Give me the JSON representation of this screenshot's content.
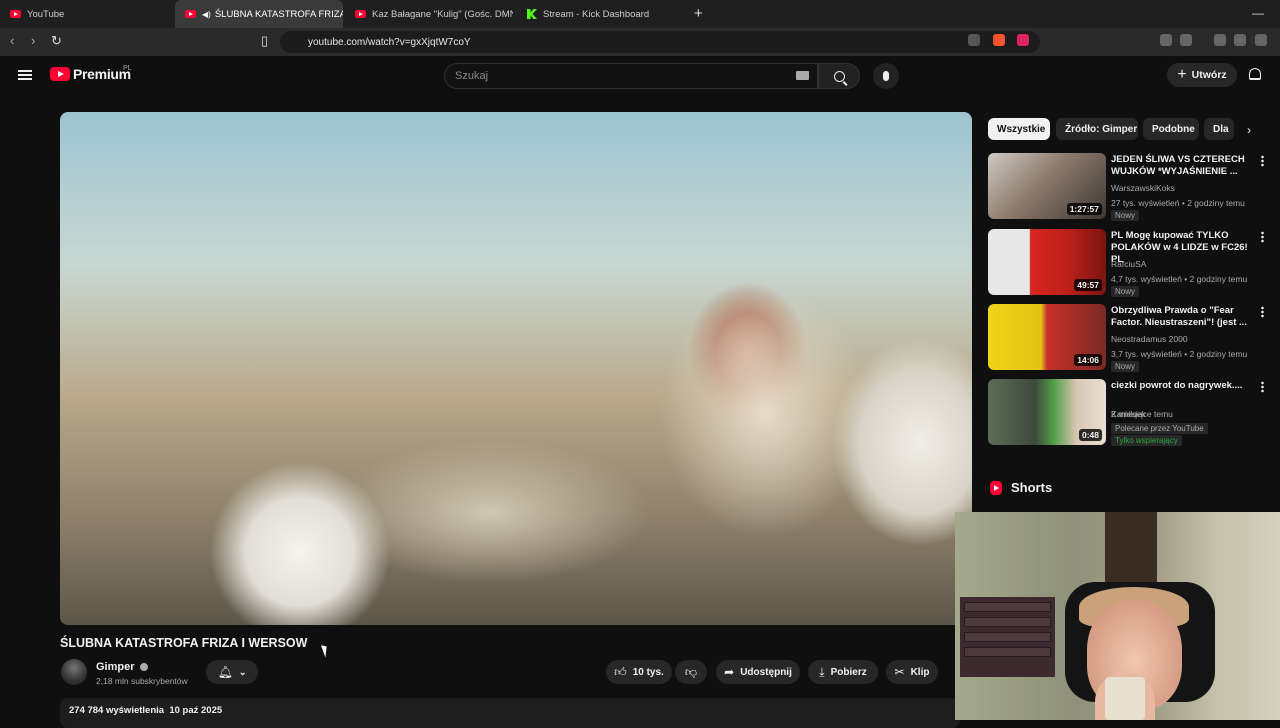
{
  "browser": {
    "tabs": [
      {
        "title": "YouTube",
        "icon": "youtube-icon"
      },
      {
        "title": "ŚLUBNA KATASTROFA FRIZA I",
        "icon": "youtube-icon",
        "active": true
      },
      {
        "title": "Kaz Bałagane \"Kulig\" (Gośc. DMN)@",
        "icon": "youtube-icon"
      },
      {
        "title": "Stream - Kick Dashboard",
        "icon": "kick-icon"
      }
    ],
    "new_tab": "+",
    "minimize": "—",
    "url": "youtube.com/watch?v=gxXjqtW7coY"
  },
  "youtube": {
    "logo": "Premium",
    "logo_region": "PL",
    "search_placeholder": "Szukaj",
    "create_label": "Utwórz",
    "video": {
      "title": "ŚLUBNA KATASTROFA FRIZA I WERSOW",
      "channel": "Gimper",
      "subscribers": "2,18 mln subskrybentów",
      "likes": "10 tys.",
      "share": "Udostępnij",
      "download": "Pobierz",
      "clip": "Klip",
      "views_date": "274 784 wyświetlenia  10 paź 2025"
    },
    "chips": [
      "Wszystkie",
      "Źródło: Gimper",
      "Podobne",
      "Dla"
    ],
    "recommendations": [
      {
        "title": "JEDEN ŚLIWA VS CZTERECH WUJKÓW *WYJAŚNIENIE ...",
        "channel": "WarszawskiKoks",
        "meta": "27 tys. wyświetleń • 2 godziny temu",
        "badge": "Nowy",
        "duration": "1:27:57"
      },
      {
        "title": "PL Mogę kupować TYLKO POLAKÓW w 4 LIDZE w FC26! PL",
        "channel": "RafciuSA",
        "meta": "4,7 tys. wyświetleń • 2 godziny temu",
        "badge": "Nowy",
        "duration": "49:57"
      },
      {
        "title": "Obrzydliwa Prawda o \"Fear Factor. Nieustraszeni\"! (jest ...",
        "channel": "Neostradamus 2000",
        "meta": "3,7 tys. wyświetleń • 2 godziny temu",
        "badge": "Nowy",
        "duration": "14:06"
      },
      {
        "title": "ciezki powrot do nagrywek....",
        "channel": "Kamilqek",
        "meta": "2 miesiące temu",
        "badge": "Polecane przez YouTube",
        "badge2": "Tylko wspierający",
        "duration": "0:48"
      }
    ],
    "shorts_label": "Shorts"
  }
}
